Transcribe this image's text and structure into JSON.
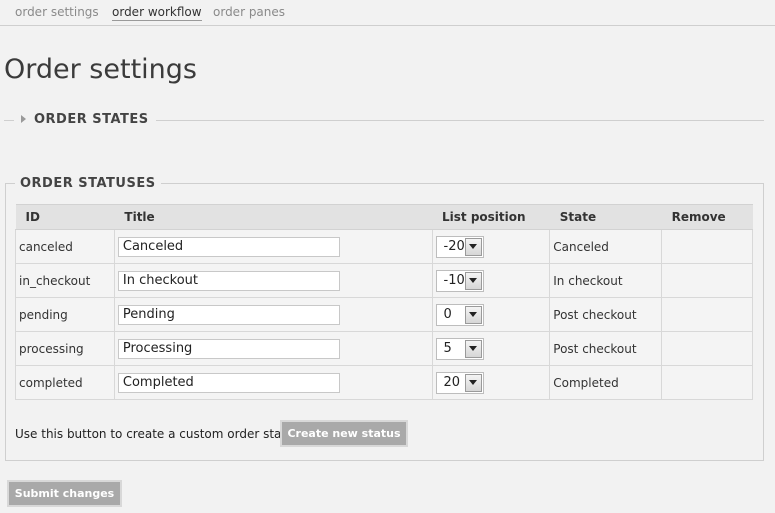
{
  "tabs": [
    {
      "label": "order settings",
      "active": false
    },
    {
      "label": "order workflow",
      "active": true
    },
    {
      "label": "order panes",
      "active": false
    }
  ],
  "page_title": "Order settings",
  "order_states": {
    "legend": "ORDER STATES",
    "icon": "triangle-right-icon"
  },
  "order_statuses": {
    "legend": "ORDER STATUSES",
    "columns": [
      "ID",
      "Title",
      "List position",
      "State",
      "Remove"
    ],
    "rows": [
      {
        "id": "canceled",
        "title": "Canceled",
        "position": "-20",
        "state": "Canceled"
      },
      {
        "id": "in_checkout",
        "title": "In checkout",
        "position": "-10",
        "state": "In checkout"
      },
      {
        "id": "pending",
        "title": "Pending",
        "position": "0",
        "state": "Post checkout"
      },
      {
        "id": "processing",
        "title": "Processing",
        "position": "5",
        "state": "Post checkout"
      },
      {
        "id": "completed",
        "title": "Completed",
        "position": "20",
        "state": "Completed"
      }
    ],
    "create_note": "Use this button to create a custom order status:",
    "create_button": "Create new status"
  },
  "submit_button": "Submit changes"
}
